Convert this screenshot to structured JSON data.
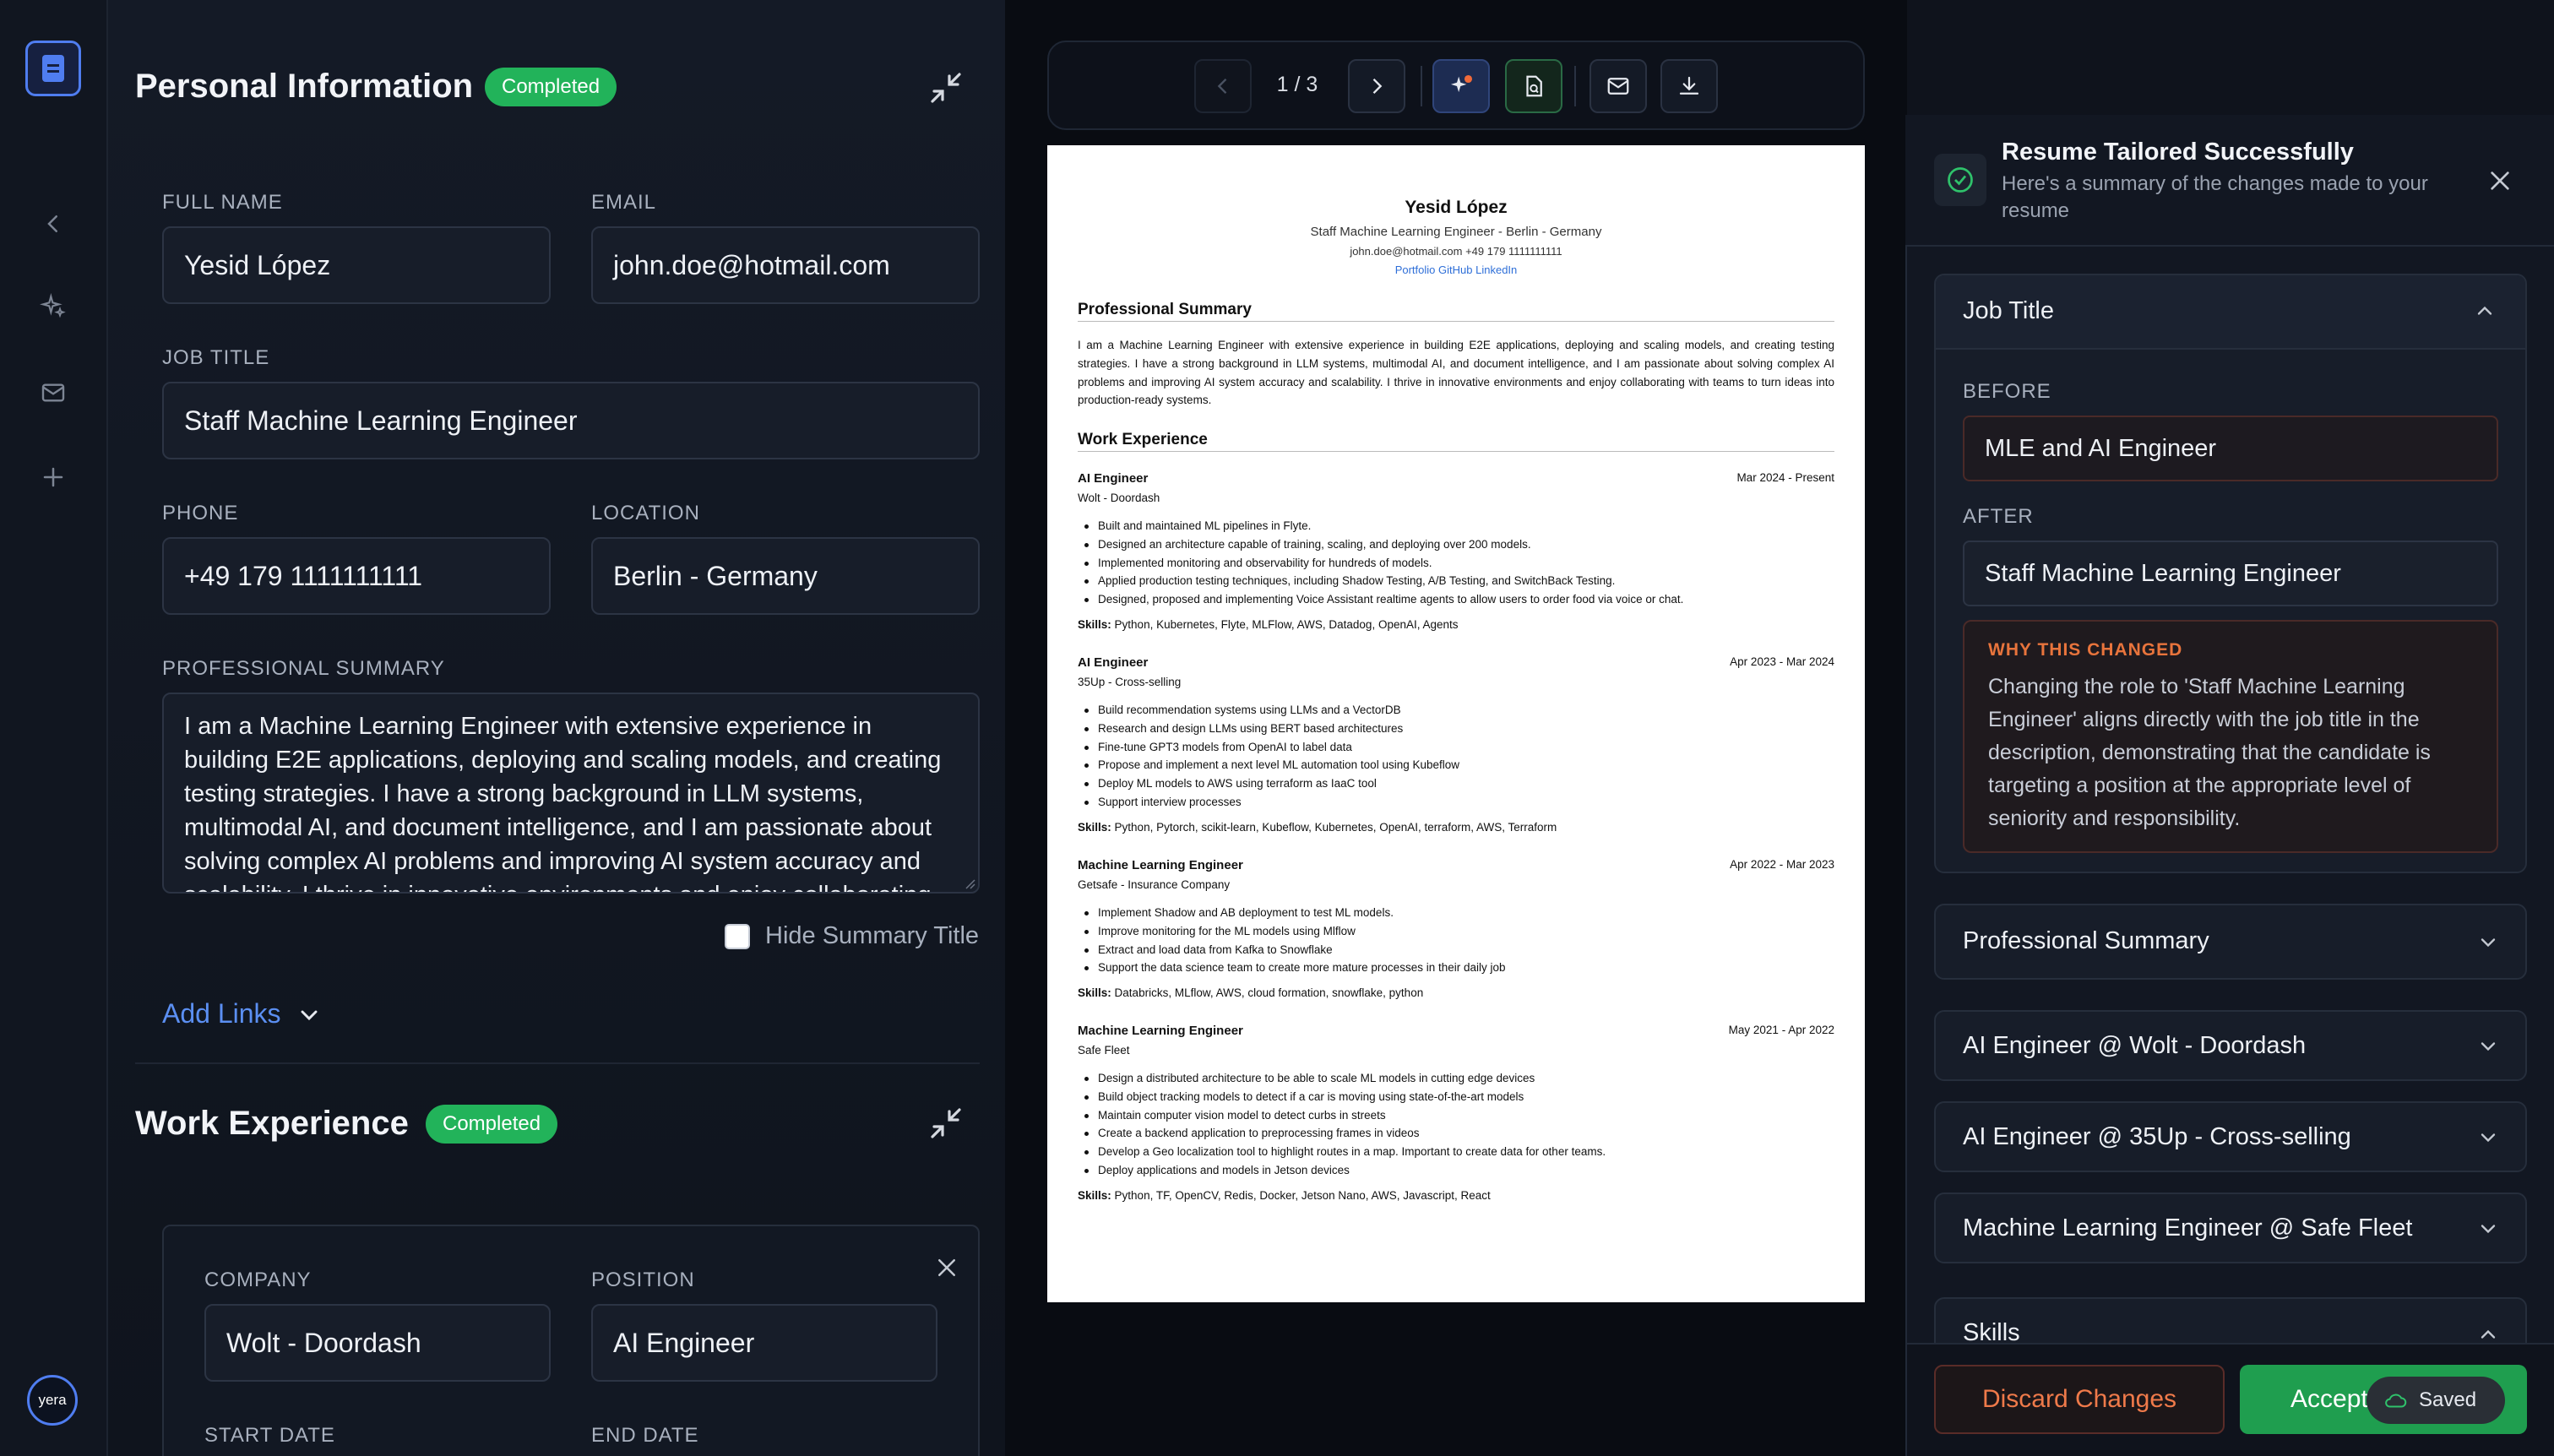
{
  "sidebar": {
    "avatar_label": "yera"
  },
  "personal": {
    "title": "Personal Information",
    "badge": "Completed",
    "full_name_label": "FULL NAME",
    "full_name": "Yesid López",
    "email_label": "EMAIL",
    "email": "john.doe@hotmail.com",
    "job_title_label": "JOB TITLE",
    "job_title": "Staff Machine Learning Engineer",
    "phone_label": "PHONE",
    "phone": "+49 179 1111111111",
    "location_label": "LOCATION",
    "location": "Berlin - Germany",
    "summary_label": "PROFESSIONAL SUMMARY",
    "summary": "I am a Machine Learning Engineer with extensive experience in building E2E applications, deploying and scaling models, and creating testing strategies. I have a strong background in LLM systems, multimodal AI, and document intelligence, and I am passionate about solving complex AI problems and improving AI system accuracy and scalability. I thrive in innovative environments and enjoy collaborating",
    "hide_summary_label": "Hide Summary Title",
    "add_links_label": "Add Links"
  },
  "work": {
    "title": "Work Experience",
    "badge": "Completed",
    "company_label": "COMPANY",
    "company": "Wolt - Doordash",
    "position_label": "POSITION",
    "position": "AI Engineer",
    "start_label": "START DATE",
    "end_label": "END DATE"
  },
  "toolbar": {
    "page_indicator": "1 / 3"
  },
  "resume": {
    "name": "Yesid López",
    "headline": "Staff Machine Learning Engineer - Berlin - Germany",
    "contact": "john.doe@hotmail.com   +49 179 1111111111",
    "links": [
      "Portfolio",
      "GitHub",
      "LinkedIn"
    ],
    "summary_heading": "Professional Summary",
    "summary": "I am a Machine Learning Engineer with extensive experience in building E2E applications, deploying and scaling models, and creating testing strategies. I have a strong background in LLM systems, multimodal AI, and document intelligence, and I am passionate about solving complex AI problems and improving AI system accuracy and scalability. I thrive in innovative environments and enjoy collaborating with teams to turn ideas into production-ready systems.",
    "experience_heading": "Work Experience",
    "jobs": [
      {
        "title": "AI Engineer",
        "dates": "Mar 2024 - Present",
        "company": "Wolt - Doordash",
        "bullets": [
          "Built and maintained ML pipelines in Flyte.",
          "Designed an architecture capable of training, scaling, and deploying over 200 models.",
          "Implemented monitoring and observability for hundreds of models.",
          "Applied production testing techniques, including Shadow Testing, A/B Testing, and SwitchBack Testing.",
          "Designed, proposed and implementing Voice Assistant realtime agents to allow users to order food via voice or chat."
        ],
        "skills_label": "Skills:",
        "skills": "Python, Kubernetes, Flyte, MLFlow, AWS, Datadog, OpenAI, Agents"
      },
      {
        "title": "AI Engineer",
        "dates": "Apr 2023 - Mar 2024",
        "company": "35Up - Cross-selling",
        "bullets": [
          "Build recommendation systems using LLMs and a VectorDB",
          "Research and design LLMs using BERT based architectures",
          "Fine-tune GPT3 models from OpenAI to label data",
          "Propose and implement a next level ML automation tool using Kubeflow",
          "Deploy ML models to AWS using terraform as IaaC tool",
          "Support interview processes"
        ],
        "skills_label": "Skills:",
        "skills": "Python, Pytorch, scikit-learn, Kubeflow, Kubernetes, OpenAI, terraform, AWS, Terraform"
      },
      {
        "title": "Machine Learning Engineer",
        "dates": "Apr 2022 - Mar 2023",
        "company": "Getsafe - Insurance Company",
        "bullets": [
          "Implement Shadow and AB deployment to test ML models.",
          "Improve monitoring for the ML models using Mlflow",
          "Extract and load data from Kafka to Snowflake",
          "Support the data science team to create more mature processes in their daily job"
        ],
        "skills_label": "Skills:",
        "skills": "Databricks, MLflow, AWS, cloud formation, snowflake, python"
      },
      {
        "title": "Machine Learning Engineer",
        "dates": "May 2021 - Apr 2022",
        "company": "Safe Fleet",
        "bullets": [
          "Design a distributed architecture to be able to scale ML models in cutting edge devices",
          "Build object tracking models to detect if a car is moving using state-of-the-art models",
          "Maintain computer vision model to detect curbs in streets",
          "Create a backend application to preprocessing frames in videos",
          "Develop a Geo localization tool to highlight routes in a map. Important to create data for other teams.",
          "Deploy applications and models in Jetson devices"
        ],
        "skills_label": "Skills:",
        "skills": "Python, TF, OpenCV, Redis, Docker, Jetson Nano, AWS, Javascript, React"
      }
    ]
  },
  "panel": {
    "title": "Resume Tailored Successfully",
    "subtitle": "Here's a summary of the changes made to your resume",
    "job_title_section": "Job Title",
    "before_label": "BEFORE",
    "before_value": "MLE and AI Engineer",
    "after_label": "AFTER",
    "after_value": "Staff Machine Learning Engineer",
    "why_label": "WHY THIS CHANGED",
    "why_text": "Changing the role to 'Staff Machine Learning Engineer' aligns directly with the job title in the description, demonstrating that the candidate is targeting a position at the appropriate level of seniority and responsibility.",
    "sections": [
      "Professional Summary",
      "AI Engineer @ Wolt - Doordash",
      "AI Engineer @ 35Up - Cross-selling",
      "Machine Learning Engineer @ Safe Fleet",
      "Skills"
    ],
    "discard_label": "Discard Changes",
    "accept_label": "Accept",
    "saved_label": "Saved"
  }
}
